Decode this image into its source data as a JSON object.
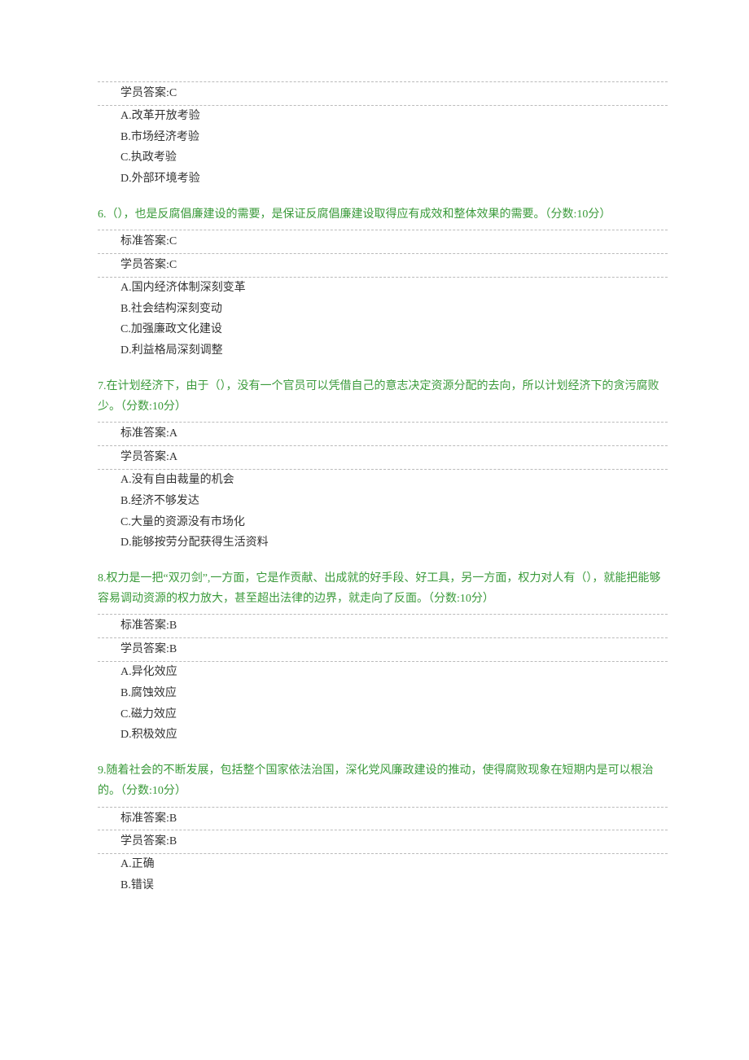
{
  "labels": {
    "standard_answer_prefix": "标准答案:",
    "student_answer_prefix": "学员答案:"
  },
  "questions": [
    {
      "stem": "",
      "standard_answer": "",
      "student_answer": "C",
      "options": [
        "A.改革开放考验",
        "B.市场经济考验",
        "C.执政考验",
        "D.外部环境考验"
      ],
      "show_standard": false,
      "show_stem": false,
      "first": true
    },
    {
      "stem": "6.（），也是反腐倡廉建设的需要，是保证反腐倡廉建设取得应有成效和整体效果的需要。（分数:10分）",
      "standard_answer": "C",
      "student_answer": "C",
      "options": [
        "A.国内经济体制深刻变革",
        "B.社会结构深刻变动",
        "C.加强廉政文化建设",
        "D.利益格局深刻调整"
      ],
      "show_standard": true,
      "show_stem": true
    },
    {
      "stem": "7.在计划经济下，由于（），没有一个官员可以凭借自己的意志决定资源分配的去向，所以计划经济下的贪污腐败少。（分数:10分）",
      "standard_answer": "A",
      "student_answer": "A",
      "options": [
        "A.没有自由裁量的机会",
        "B.经济不够发达",
        "C.大量的资源没有市场化",
        "D.能够按劳分配获得生活资料"
      ],
      "show_standard": true,
      "show_stem": true
    },
    {
      "stem": "8.权力是一把“双刃剑”,一方面，它是作贡献、出成就的好手段、好工具，另一方面，权力对人有（），就能把能够容易调动资源的权力放大，甚至超出法律的边界，就走向了反面。（分数:10分）",
      "standard_answer": "B",
      "student_answer": "B",
      "options": [
        "A.异化效应",
        "B.腐蚀效应",
        "C.磁力效应",
        "D.积极效应"
      ],
      "show_standard": true,
      "show_stem": true
    },
    {
      "stem": "9.随着社会的不断发展，包括整个国家依法治国，深化党风廉政建设的推动，使得腐败现象在短期内是可以根治的。（分数:10分）",
      "standard_answer": "B",
      "student_answer": "B",
      "options": [
        "A.正确",
        "B.错误"
      ],
      "show_standard": true,
      "show_stem": true
    }
  ]
}
